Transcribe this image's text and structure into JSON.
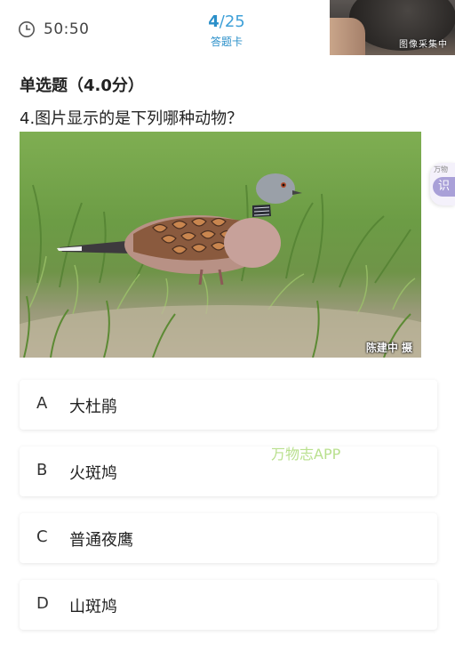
{
  "header": {
    "timer_icon": "clock-icon",
    "timer": "50:50",
    "progress_current": "4",
    "progress_total": "/25",
    "answer_card_label": "答题卡",
    "camera_status": "图像采集中"
  },
  "question": {
    "type_label": "单选题（4.0分）",
    "text": "4.图片显示的是下列哪种动物？",
    "image_credit": "陈建中 摄"
  },
  "options": [
    {
      "letter": "A",
      "text": "大杜鹃"
    },
    {
      "letter": "B",
      "text": "火斑鸠"
    },
    {
      "letter": "C",
      "text": "普通夜鹰"
    },
    {
      "letter": "D",
      "text": "山斑鸠"
    }
  ],
  "side_tab": {
    "mini_label": "万物",
    "button_label": "识"
  },
  "watermark": "万物志APP",
  "colors": {
    "accent": "#2a8fc9",
    "watermark": "#b9e08e",
    "side_tab": "#a9a0d8"
  }
}
